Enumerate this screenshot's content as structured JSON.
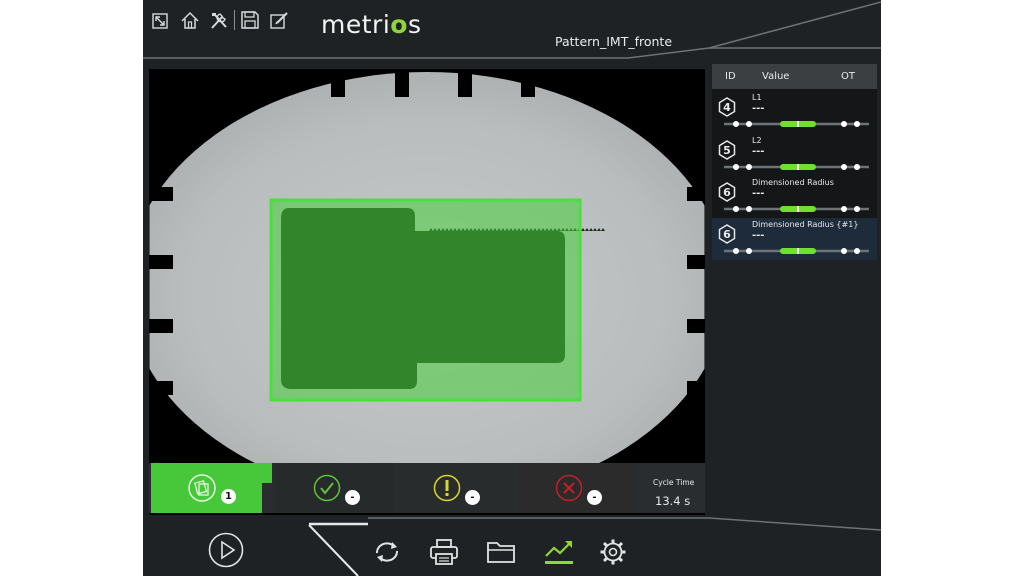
{
  "app": {
    "logo_prefix": "metri",
    "logo_accent": "o",
    "logo_suffix": "s",
    "project_title": "Pattern_IMT_fronte"
  },
  "toolbar": {
    "icons": [
      "collapse-icon",
      "home-icon",
      "tools-icon",
      "save-icon",
      "edit-icon"
    ]
  },
  "measurements_table": {
    "headers": {
      "id": "ID",
      "value": "Value",
      "ot": "OT"
    },
    "rows": [
      {
        "id": "4",
        "name": "L1",
        "value": "---"
      },
      {
        "id": "5",
        "name": "L2",
        "value": "---"
      },
      {
        "id": "6",
        "name": "Dimensioned Radius",
        "value": "---"
      },
      {
        "id": "6",
        "name": "Dimensioned Radius {#1}",
        "value": "---"
      }
    ]
  },
  "status_counters": {
    "parts_count": "1",
    "ok_count": "-",
    "warning_count": "-",
    "fail_count": "-"
  },
  "cycle_time": {
    "label": "Cycle Time",
    "value": "13.4 s"
  },
  "bottom_nav": {
    "icons": [
      "play-icon",
      "cycle-icon",
      "print-icon",
      "folder-icon",
      "trend-icon",
      "settings-icon"
    ]
  },
  "colors": {
    "accent_green": "#8fd63a",
    "ok_green": "#5ec23a",
    "warning_yellow": "#d8d62a",
    "fail_red": "#c0202a",
    "background": "#1f2224"
  }
}
